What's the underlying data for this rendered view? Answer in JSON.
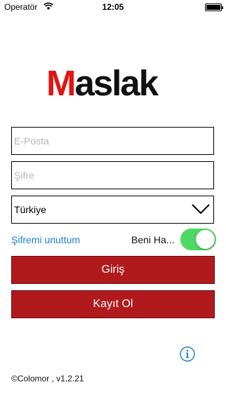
{
  "status_bar": {
    "carrier": "Operatör",
    "time": "12:05",
    "icons": [
      "wifi-icon",
      "battery-icon"
    ]
  },
  "logo": {
    "first_letter": "M",
    "rest": "aslak",
    "colors": {
      "first": "#e01414",
      "rest": "#111111"
    }
  },
  "form": {
    "email_placeholder": "E-Posta",
    "email_value": "",
    "password_placeholder": "Şifre",
    "password_value": "",
    "country_selected": "Türkiye",
    "forgot_password": "Şifremi unuttum",
    "remember_me": "Beni Ha...",
    "remember_me_on": true,
    "login_label": "Giriş",
    "register_label": "Kayıt Ol"
  },
  "footer": {
    "version": "©Colomor , v1.2.21",
    "info_icon": "info-icon"
  },
  "colors": {
    "accent": "#b01a1d",
    "link": "#1a7fd6",
    "toggle_on": "#4cd964"
  }
}
